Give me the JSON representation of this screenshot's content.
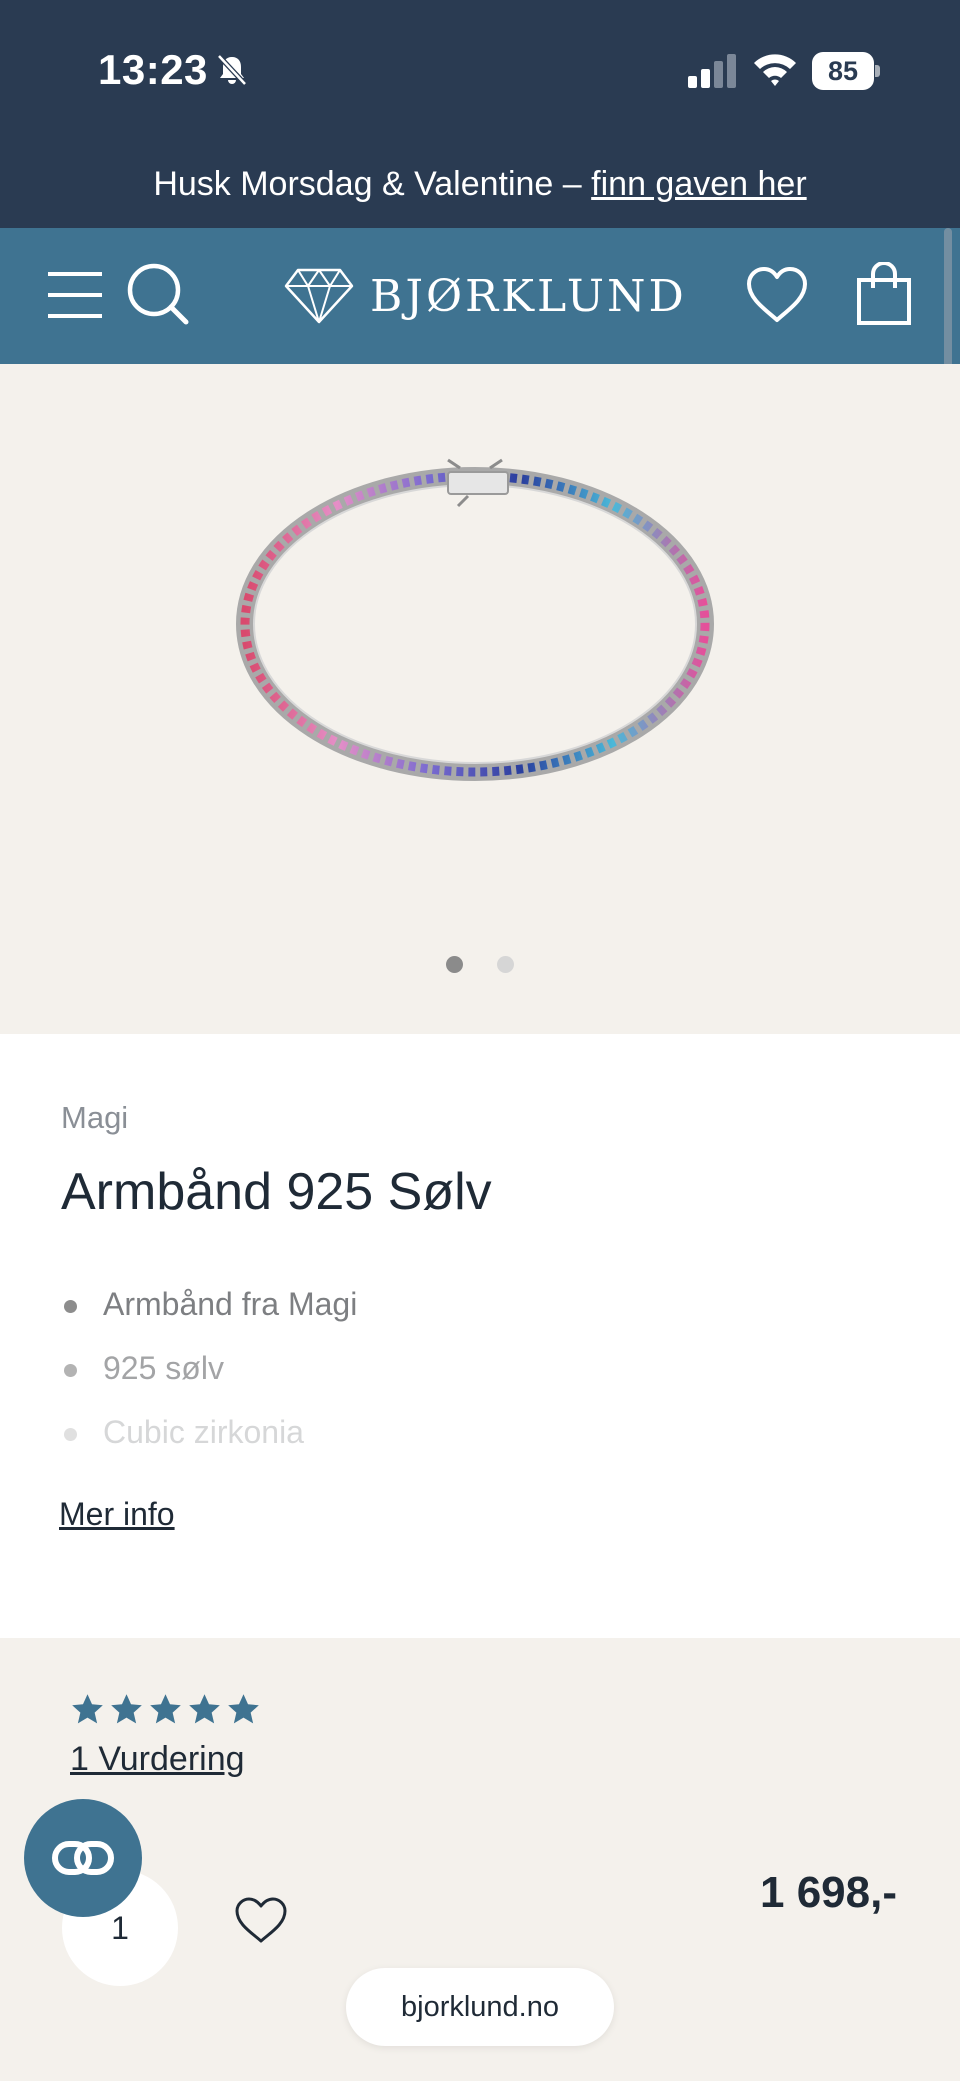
{
  "status_bar": {
    "time": "13:23",
    "battery": "85"
  },
  "announcement": {
    "text": "Husk Morsdag & Valentine – ",
    "link": "finn gaven her"
  },
  "header": {
    "logo_text": "BJØRKLUND"
  },
  "gallery": {
    "slides": 2,
    "active_slide": 1
  },
  "product": {
    "brand": "Magi",
    "title": "Armbånd 925 Sølv",
    "features": [
      "Armbånd fra Magi",
      "925 sølv",
      "Cubic zirkonia"
    ],
    "more_info": "Mer info"
  },
  "reviews": {
    "rating": 5,
    "max_rating": 5,
    "count_label": "1 Vurdering"
  },
  "purchase": {
    "quantity": "1",
    "price": "1 698,-"
  },
  "browser": {
    "url": "bjorklund.no"
  },
  "colors": {
    "navy": "#2a3b52",
    "teal": "#3f7391",
    "beige": "#f4f1ec"
  }
}
